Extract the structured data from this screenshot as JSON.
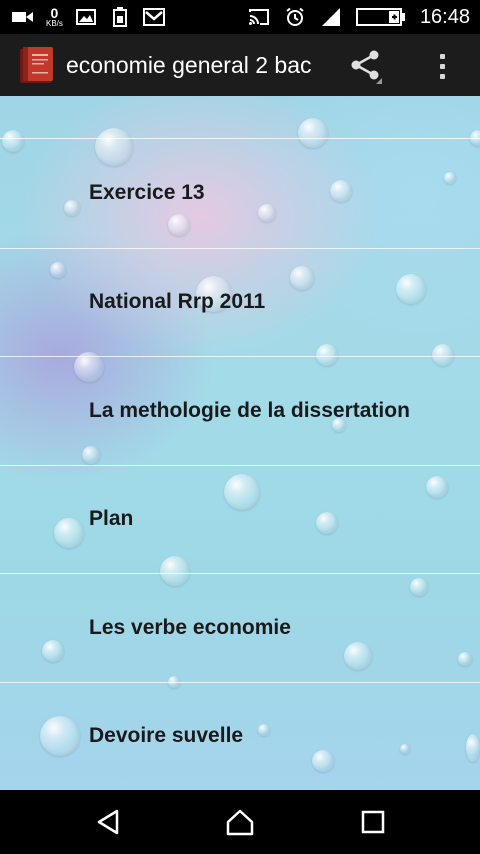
{
  "status_bar": {
    "speed_value": "0",
    "speed_unit": "KB/s",
    "time": "16:48",
    "icons": [
      "video-camera-icon",
      "image-icon",
      "battery-saver-icon",
      "gmail-icon",
      "cast-icon",
      "alarm-icon",
      "signal-icon",
      "battery-charging-icon"
    ]
  },
  "app_bar": {
    "title": "economie general 2 bac",
    "icons": [
      "book-logo-icon",
      "share-icon",
      "more-vert-icon"
    ]
  },
  "list": {
    "items": [
      {
        "label": "Exercice 13"
      },
      {
        "label": "National Rrp 2011"
      },
      {
        "label": "La methologie de la dissertation"
      },
      {
        "label": "Plan"
      },
      {
        "label": "Les verbe economie"
      },
      {
        "label": "Devoire suvelle"
      }
    ]
  },
  "nav_bar": {
    "icons": [
      "back-icon",
      "home-icon",
      "recents-icon"
    ]
  }
}
